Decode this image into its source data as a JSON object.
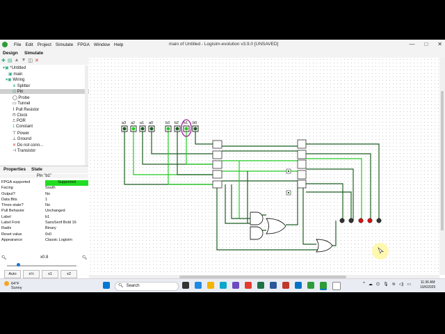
{
  "window": {
    "title": "main of Untitled - Logisim-evolution v3.9.0 [UNSAVED]",
    "menu": [
      "File",
      "Edit",
      "Project",
      "Simulate",
      "FPGA",
      "Window",
      "Help"
    ],
    "controls": [
      "—",
      "□",
      "✕"
    ]
  },
  "tabs": {
    "design": "Design",
    "simulate": "Simulate"
  },
  "tree": {
    "project": "*Untitled",
    "circuit": "main",
    "folder": "Wiring",
    "items": [
      "Splitter",
      "Pin",
      "Probe",
      "Tunnel",
      "Pull Resistor",
      "Clock",
      "POR",
      "Constant",
      "Power",
      "Ground",
      "Do not conn...",
      "Transistor"
    ],
    "selected": "Pin"
  },
  "panel_tabs": {
    "properties": "Properties",
    "state": "State"
  },
  "properties": {
    "title": "Pin \"b1\"",
    "rows": [
      {
        "k": "FPGA supported",
        "v": "Supported"
      },
      {
        "k": "Facing",
        "v": "South"
      },
      {
        "k": "Output?",
        "v": "No"
      },
      {
        "k": "Data Bits",
        "v": "1"
      },
      {
        "k": "Three-state?",
        "v": "No"
      },
      {
        "k": "Pull Behavior",
        "v": "Unchanged"
      },
      {
        "k": "Label",
        "v": "b1"
      },
      {
        "k": "Label Font",
        "v": "SansSerif Bold 16"
      },
      {
        "k": "Radix",
        "v": "Binary"
      },
      {
        "k": "Reset value",
        "v": "0x0"
      },
      {
        "k": "Appearance",
        "v": "Classic Logisim"
      }
    ]
  },
  "zoom": {
    "label": "x0.8",
    "buttons": [
      "Auto",
      "x½",
      "x1",
      "x2"
    ],
    "level": 0.8
  },
  "circuit": {
    "pin_labels": [
      "a3",
      "a2",
      "a1",
      "a0",
      "b3",
      "b2",
      "b1",
      "b0"
    ]
  },
  "taskbar": {
    "weather_temp": "64°F",
    "weather_desc": "Sunny",
    "search": "Search",
    "time": "11:36 AM",
    "date": "10/6/2025"
  },
  "colors": {
    "wire_on": "#22cc22",
    "wire_off": "#1b5e20",
    "selection": "#a020a0",
    "led_on": "#dd1111",
    "led_off": "#333333"
  }
}
